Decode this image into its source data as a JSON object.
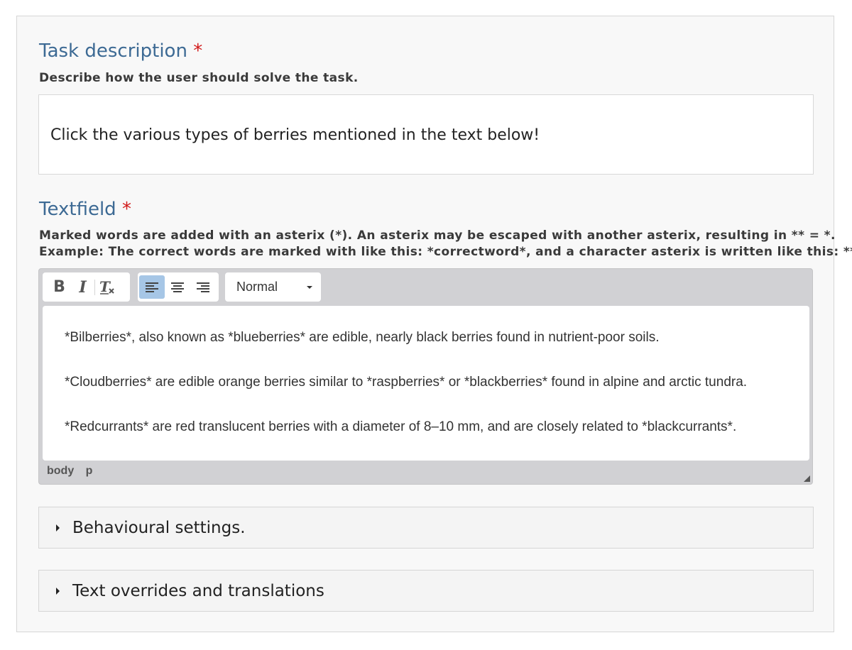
{
  "task": {
    "title": "Task description",
    "required": "*",
    "description": "Describe how the user should solve the task.",
    "value": "Click the various types of berries mentioned in the text below!"
  },
  "textfield": {
    "title": "Textfield",
    "required": "*",
    "description_line1": "Marked words are added with an asterix (*). An asterix may be escaped with another asterix, resulting in ** = *.",
    "description_line2": "Example: The correct words are marked with like this: *correctword*, and a character asterix is written like this: **."
  },
  "toolbar": {
    "bold_label": "B",
    "italic_label": "I",
    "clear_format_label": "Tx",
    "format_value": "Normal",
    "icons": [
      "bold-icon",
      "italic-icon",
      "remove-format-icon",
      "align-left-icon",
      "align-center-icon",
      "align-right-icon"
    ],
    "active_align": "left",
    "active_color": "#a6c6e6"
  },
  "editor": {
    "paragraphs": [
      "*Bilberries*, also known as *blueberries* are edible, nearly black berries found in nutrient-poor soils.",
      "*Cloudberries* are edible orange berries similar to *raspberries* or *blackberries* found in alpine and arctic tundra.",
      "*Redcurrants* are red translucent berries with a diameter of 8–10 mm, and are closely related to *blackcurrants*."
    ],
    "path": [
      "body",
      "p"
    ]
  },
  "sections": [
    {
      "label": "Behavioural settings."
    },
    {
      "label": "Text overrides and translations"
    }
  ],
  "colors": {
    "title": "#3d6a94",
    "required": "#d11a1a"
  }
}
